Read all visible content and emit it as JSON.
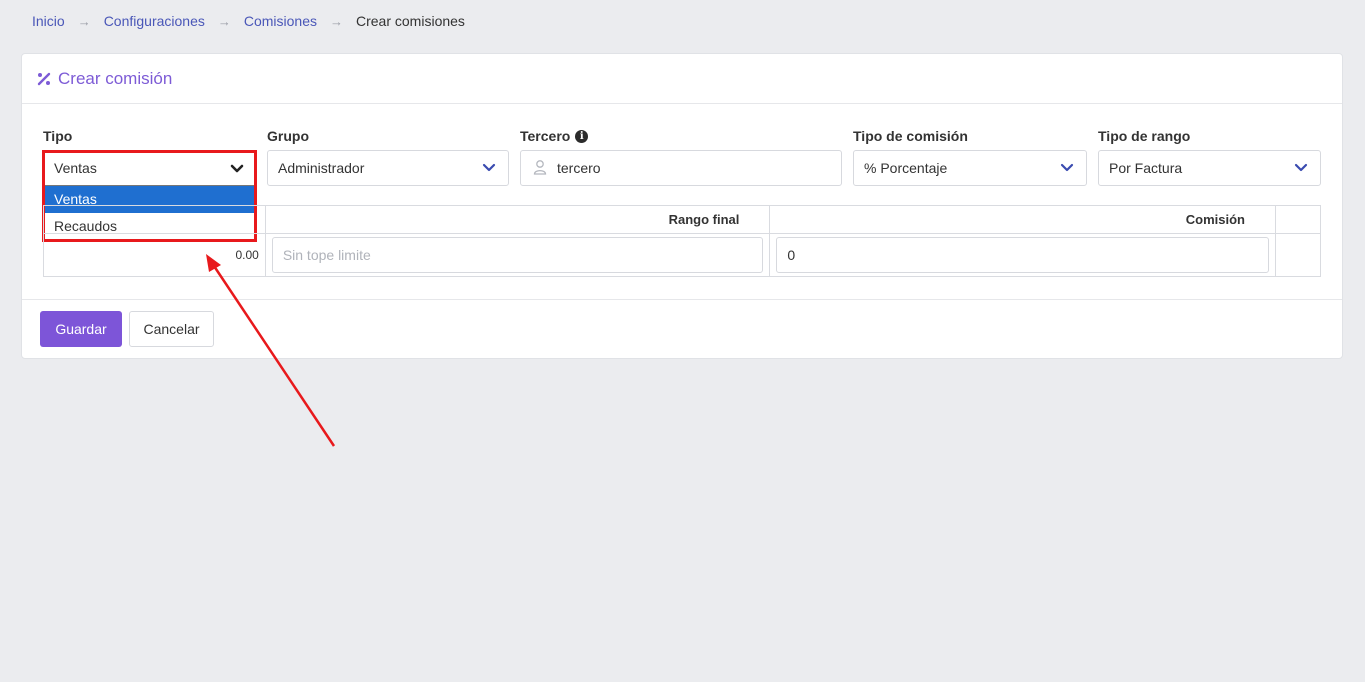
{
  "breadcrumb": {
    "items": [
      "Inicio",
      "Configuraciones",
      "Comisiones"
    ],
    "current": "Crear comisiones",
    "separator": "→"
  },
  "card": {
    "title": "Crear comisión",
    "icon": "percent-icon"
  },
  "form": {
    "tipo": {
      "label": "Tipo",
      "value": "Ventas",
      "options": [
        "Ventas",
        "Recaudos"
      ],
      "active_option": "Ventas"
    },
    "grupo": {
      "label": "Grupo",
      "value": "Administrador"
    },
    "tercero": {
      "label": "Tercero",
      "placeholder": "tercero"
    },
    "tipo_comision": {
      "label": "Tipo de comisión",
      "value": "% Porcentaje"
    },
    "tipo_rango": {
      "label": "Tipo de rango",
      "value": "Por Factura"
    }
  },
  "table": {
    "headers": [
      "",
      "Rango final",
      "Comisión",
      ""
    ],
    "row": {
      "rango_inicial": "0.00",
      "rango_final_placeholder": "Sin tope limite",
      "comision": "0"
    }
  },
  "buttons": {
    "save": "Guardar",
    "cancel": "Cancelar"
  },
  "colors": {
    "accent": "#7d55d8",
    "link": "#4a57b8",
    "highlight": "#e8191c",
    "selected_option": "#1f6fd0"
  }
}
